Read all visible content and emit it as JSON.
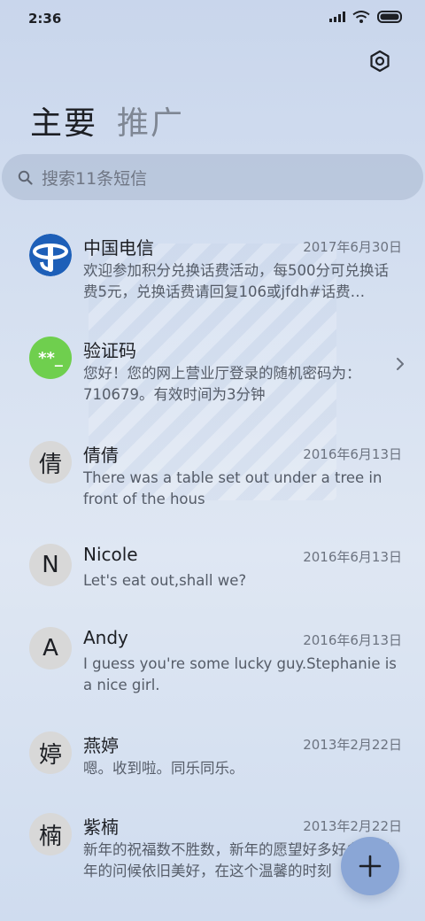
{
  "status": {
    "time": "2:36"
  },
  "tabs": {
    "primary": "主要",
    "promo": "推广"
  },
  "search": {
    "placeholder": "搜索11条短信"
  },
  "messages": [
    {
      "avatar": "",
      "name": "中国电信",
      "date": "2017年6月30日",
      "preview": "欢迎参加积分兑换话费活动，每500分可兑换话费5元，兑换话费请回复106或jfdh#话费…"
    },
    {
      "avatar": "**_",
      "name": "验证码",
      "date": "",
      "preview": "您好！您的网上营业厅登录的随机密码为：710679。有效时间为3分钟"
    },
    {
      "avatar": "倩",
      "name": "倩倩",
      "date": "2016年6月13日",
      "preview": "There was a table set out under a tree in front of the hous"
    },
    {
      "avatar": "N",
      "name": "Nicole",
      "date": "2016年6月13日",
      "preview": "Let's eat out,shall we?"
    },
    {
      "avatar": "A",
      "name": "Andy",
      "date": "2016年6月13日",
      "preview": "I guess you're some lucky guy.Stephanie is a nice girl."
    },
    {
      "avatar": "婷",
      "name": "燕婷",
      "date": "2013年2月22日",
      "preview": "嗯。收到啦。同乐同乐。"
    },
    {
      "avatar": "楠",
      "name": "紫楠",
      "date": "2013年2月22日",
      "preview": "新年的祝福数不胜数，新年的愿望好多好多，新年的问候依旧美好，在这个温馨的时刻"
    }
  ],
  "colors": {
    "telecom_blue": "#1d5fb8",
    "verify_green": "#6fcf4e",
    "fab": "#8aa6d6"
  }
}
